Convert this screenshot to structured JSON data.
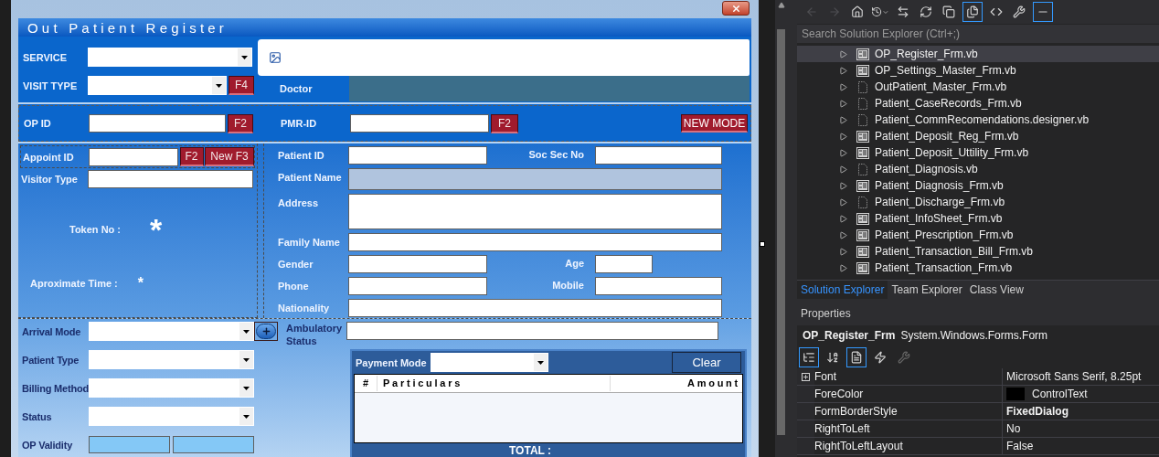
{
  "form": {
    "title": "Out Patient Register"
  },
  "header": {
    "service": {
      "label": "SERVICE"
    },
    "visit_type": {
      "label": "VISIT TYPE",
      "button": "F4"
    },
    "doctor": {
      "label": "Doctor"
    }
  },
  "ids": {
    "op_id": {
      "label": "OP ID",
      "button": "F2"
    },
    "pmr_id": {
      "label": "PMR-ID",
      "button": "F2"
    },
    "mode_button": "NEW MODE"
  },
  "appointment": {
    "appoint_label": "Appoint ID",
    "appoint_buttons": [
      "F2",
      "New F3"
    ],
    "visitor_label": "Visitor Type",
    "token_label": "Token No :",
    "token_value": "*",
    "time_label": "Aproximate Time :",
    "time_value": "*"
  },
  "patient": {
    "rows": [
      {
        "fields": [
          {
            "label": "Patient ID",
            "kind": "short",
            "readonly": false
          },
          {
            "label": "Soc Sec No",
            "kind": "short",
            "readonly": false
          }
        ]
      },
      {
        "fields": [
          {
            "label": "Patient Name",
            "kind": "wide",
            "readonly": true
          }
        ]
      },
      {
        "fields": [
          {
            "label": "Address",
            "kind": "tall",
            "readonly": false
          }
        ]
      },
      {
        "fields": [
          {
            "label": "Family Name",
            "kind": "wide",
            "readonly": false
          }
        ]
      },
      {
        "fields": [
          {
            "label": "Gender",
            "kind": "short",
            "readonly": false
          },
          {
            "label": "Age",
            "kind": "tiny",
            "readonly": false
          }
        ]
      },
      {
        "fields": [
          {
            "label": "Phone",
            "kind": "short",
            "readonly": false
          },
          {
            "label": "Mobile",
            "kind": "short",
            "readonly": false
          }
        ]
      },
      {
        "fields": [
          {
            "label": "Nationality",
            "kind": "wide",
            "readonly": false
          }
        ]
      }
    ]
  },
  "visit": [
    {
      "label": "Arrival Mode",
      "kind": "combo_add"
    },
    {
      "label": "Patient Type",
      "kind": "combo"
    },
    {
      "label": "Billing Method",
      "kind": "combo"
    },
    {
      "label": "Status",
      "kind": "combo"
    },
    {
      "label": "OP Validity",
      "kind": "dates"
    }
  ],
  "ambulatory": {
    "label": "Ambulatory Status"
  },
  "payment": {
    "label": "Payment Mode",
    "clear_button": "Clear",
    "columns": [
      "#",
      "Particulars",
      "Amount"
    ],
    "total_label": "TOTAL :"
  },
  "solution_explorer": {
    "toolbar": [
      {
        "kind": "back",
        "selected": false,
        "disabled": true
      },
      {
        "kind": "forward",
        "selected": false,
        "disabled": true
      },
      {
        "kind": "home",
        "selected": false,
        "disabled": false
      },
      {
        "kind": "history",
        "selected": false,
        "disabled": false
      },
      {
        "kind": "sync",
        "selected": false,
        "disabled": false
      },
      {
        "kind": "refresh",
        "selected": false,
        "disabled": false
      },
      {
        "kind": "collapse",
        "selected": false,
        "disabled": false
      },
      {
        "kind": "show_files",
        "selected": true,
        "disabled": false
      },
      {
        "kind": "code",
        "selected": false,
        "disabled": false
      },
      {
        "kind": "properties",
        "selected": false,
        "disabled": false
      },
      {
        "kind": "preview",
        "selected": true,
        "disabled": false
      }
    ],
    "search": {
      "placeholder": "Search Solution Explorer (Ctrl+;)"
    },
    "items": [
      {
        "name": "OP_Register_Frm.vb",
        "kind": "form",
        "selected": true
      },
      {
        "name": "OP_Settings_Master_Frm.vb",
        "kind": "form",
        "selected": false
      },
      {
        "name": "OutPatient_Master_Frm.vb",
        "kind": "file",
        "selected": false
      },
      {
        "name": "Patient_CaseRecords_Frm.vb",
        "kind": "file",
        "selected": false
      },
      {
        "name": "Patient_CommRecomendations.designer.vb",
        "kind": "file",
        "selected": false
      },
      {
        "name": "Patient_Deposit_Reg_Frm.vb",
        "kind": "form",
        "selected": false
      },
      {
        "name": "Patient_Deposit_Uttility_Frm.vb",
        "kind": "form",
        "selected": false
      },
      {
        "name": "Patient_Diagnosis.vb",
        "kind": "file",
        "selected": false
      },
      {
        "name": "Patient_Diagnosis_Frm.vb",
        "kind": "form",
        "selected": false
      },
      {
        "name": "Patient_Discharge_Frm.vb",
        "kind": "file",
        "selected": false
      },
      {
        "name": "Patient_InfoSheet_Frm.vb",
        "kind": "form",
        "selected": false
      },
      {
        "name": "Patient_Prescription_Frm.vb",
        "kind": "form",
        "selected": false
      },
      {
        "name": "Patient_Transaction_Bill_Frm.vb",
        "kind": "form",
        "selected": false
      },
      {
        "name": "Patient_Transaction_Frm.vb",
        "kind": "form",
        "selected": false
      }
    ],
    "tabs": [
      {
        "label": "Solution Explorer",
        "selected": true
      },
      {
        "label": "Team Explorer",
        "selected": false
      },
      {
        "label": "Class View",
        "selected": false
      }
    ]
  },
  "properties": {
    "title": "Properties",
    "object_name": "OP_Register_Frm",
    "object_type": "System.Windows.Forms.Form",
    "toolbar": [
      {
        "kind": "categorized",
        "selected": true
      },
      {
        "kind": "alphabetical",
        "selected": false
      },
      {
        "kind": "properties",
        "selected": true
      },
      {
        "kind": "events",
        "selected": false
      },
      {
        "kind": "pages",
        "selected": false
      }
    ],
    "rows": [
      {
        "name": "Font",
        "value": "Microsoft Sans Serif, 8.25pt",
        "expandable": true,
        "modified": false
      },
      {
        "name": "ForeColor",
        "value": "ControlText",
        "expandable": false,
        "modified": false,
        "color": "#000000"
      },
      {
        "name": "FormBorderStyle",
        "value": "FixedDialog",
        "expandable": false,
        "modified": true
      },
      {
        "name": "RightToLeft",
        "value": "No",
        "expandable": false,
        "modified": false
      },
      {
        "name": "RightToLeftLayout",
        "value": "False",
        "expandable": false,
        "modified": false
      }
    ]
  }
}
